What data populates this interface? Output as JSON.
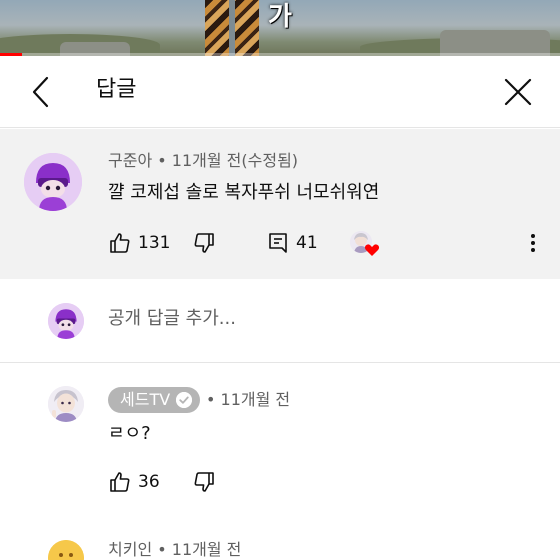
{
  "video": {
    "caption": "가",
    "progress_fraction": 0.04
  },
  "header": {
    "title": "답글"
  },
  "parent_comment": {
    "author": "구준아",
    "separator": "•",
    "time": "11개월 전(수정됨)",
    "text": "꺌 코제섭 솔로 복자푸쉬 너모쉬워연",
    "likes": "131",
    "replies": "41"
  },
  "add_reply": {
    "placeholder": "공개 답글 추가..."
  },
  "replies": [
    {
      "author": "세드TV",
      "separator": "•",
      "time": "11개월 전",
      "text": "ㄹㅇ?",
      "likes": "36"
    },
    {
      "author": "치키인",
      "separator": "•",
      "time": "11개월 전"
    }
  ],
  "colors": {
    "accent_red": "#ff0000",
    "meta_gray": "#606060",
    "highlight_bg": "#f2f2f2",
    "badge_gray": "#b5b5b5"
  },
  "icons": {
    "back": "chevron-left-icon",
    "close": "close-icon",
    "like": "thumb-up-icon",
    "dislike": "thumb-down-icon",
    "reply": "comment-icon",
    "more": "more-vert-icon",
    "verified": "check-circle-icon",
    "creator_heart": "heart-icon"
  }
}
